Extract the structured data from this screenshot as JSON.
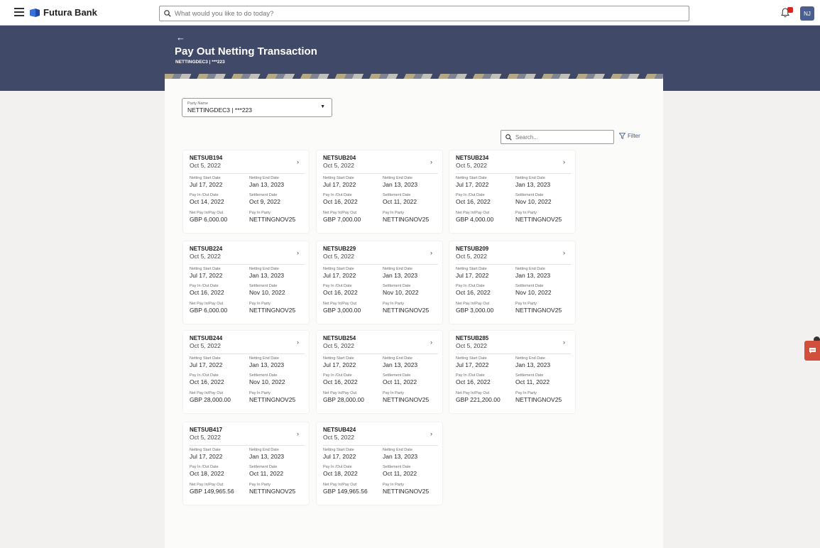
{
  "header": {
    "brand": "Futura Bank",
    "search_placeholder": "What would you like to do today?",
    "user_initials": "NJ"
  },
  "banner": {
    "back": "←",
    "title": "Pay Out Netting Transaction",
    "subtitle": "NETTINGDEC3 | ***223"
  },
  "party": {
    "label": "Party Name",
    "value": "NETTINGDEC3 | ***223"
  },
  "list": {
    "search_placeholder": "Search...",
    "filter_label": "Filter"
  },
  "field_labels": {
    "start": "Netting Start Date",
    "end": "Netting End Date",
    "payout": "Pay In /Out Date",
    "settlement": "Settlement Date",
    "net": "Net Pay In/Pay Out",
    "party": "Pay In Party"
  },
  "cards": [
    {
      "id": "NETSUB194",
      "date": "Oct 5, 2022",
      "start": "Jul 17, 2022",
      "end": "Jan 13, 2023",
      "payout": "Oct 14, 2022",
      "settlement": "Oct 9, 2022",
      "net": "GBP 6,000.00",
      "party": "NETTINGNOV25"
    },
    {
      "id": "NETSUB204",
      "date": "Oct 5, 2022",
      "start": "Jul 17, 2022",
      "end": "Jan 13, 2023",
      "payout": "Oct 16, 2022",
      "settlement": "Oct 11, 2022",
      "net": "GBP 7,000.00",
      "party": "NETTINGNOV25"
    },
    {
      "id": "NETSUB234",
      "date": "Oct 5, 2022",
      "start": "Jul 17, 2022",
      "end": "Jan 13, 2023",
      "payout": "Oct 16, 2022",
      "settlement": "Nov 10, 2022",
      "net": "GBP 4,000.00",
      "party": "NETTINGNOV25"
    },
    {
      "id": "NETSUB224",
      "date": "Oct 5, 2022",
      "start": "Jul 17, 2022",
      "end": "Jan 13, 2023",
      "payout": "Oct 16, 2022",
      "settlement": "Nov 10, 2022",
      "net": "GBP 6,000.00",
      "party": "NETTINGNOV25"
    },
    {
      "id": "NETSUB229",
      "date": "Oct 5, 2022",
      "start": "Jul 17, 2022",
      "end": "Jan 13, 2023",
      "payout": "Oct 16, 2022",
      "settlement": "Nov 10, 2022",
      "net": "GBP 3,000.00",
      "party": "NETTINGNOV25"
    },
    {
      "id": "NETSUB209",
      "date": "Oct 5, 2022",
      "start": "Jul 17, 2022",
      "end": "Jan 13, 2023",
      "payout": "Oct 16, 2022",
      "settlement": "Nov 10, 2022",
      "net": "GBP 3,000.00",
      "party": "NETTINGNOV25"
    },
    {
      "id": "NETSUB244",
      "date": "Oct 5, 2022",
      "start": "Jul 17, 2022",
      "end": "Jan 13, 2023",
      "payout": "Oct 16, 2022",
      "settlement": "Nov 10, 2022",
      "net": "GBP 28,000.00",
      "party": "NETTINGNOV25"
    },
    {
      "id": "NETSUB254",
      "date": "Oct 5, 2022",
      "start": "Jul 17, 2022",
      "end": "Jan 13, 2023",
      "payout": "Oct 16, 2022",
      "settlement": "Oct 11, 2022",
      "net": "GBP 28,000.00",
      "party": "NETTINGNOV25"
    },
    {
      "id": "NETSUB285",
      "date": "Oct 5, 2022",
      "start": "Jul 17, 2022",
      "end": "Jan 13, 2023",
      "payout": "Oct 16, 2022",
      "settlement": "Oct 11, 2022",
      "net": "GBP 221,200.00",
      "party": "NETTINGNOV25"
    },
    {
      "id": "NETSUB417",
      "date": "Oct 5, 2022",
      "start": "Jul 17, 2022",
      "end": "Jan 13, 2023",
      "payout": "Oct 18, 2022",
      "settlement": "Oct 11, 2022",
      "net": "GBP 149,965.56",
      "party": "NETTINGNOV25"
    },
    {
      "id": "NETSUB424",
      "date": "Oct 5, 2022",
      "start": "Jul 17, 2022",
      "end": "Jan 13, 2023",
      "payout": "Oct 18, 2022",
      "settlement": "Oct 11, 2022",
      "net": "GBP 149,965.56",
      "party": "NETTINGNOV25"
    }
  ],
  "icons": {
    "menu": "hamburger-icon",
    "logo": "bank-logo-icon",
    "search": "search-icon",
    "notifications": "bell-icon",
    "chevron": "chevron-right-icon",
    "caret": "caret-down-icon",
    "filter": "filter-icon",
    "chat": "chat-icon"
  },
  "colors": {
    "banner": "#414968",
    "accent": "#3c5b9a",
    "notification_badge": "#d9261c",
    "chat_fab": "#d2503b",
    "avatar": "#4a5f8f"
  }
}
